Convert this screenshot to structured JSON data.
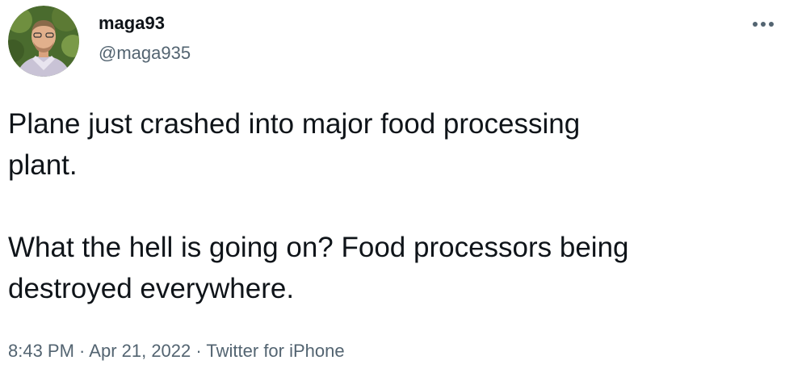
{
  "author": {
    "display_name": "maga93",
    "handle": "@maga935",
    "avatar_icon": "profile-photo"
  },
  "more_icon": "more-horizontal-icon",
  "tweet": {
    "text": "Plane just crashed into major food processing\nplant.\n\nWhat the hell is going on?  Food processors being\ndestroyed everywhere.",
    "time": "8:43 PM",
    "separator": " · ",
    "date": "Apr 21, 2022",
    "source": "Twitter for iPhone"
  },
  "colors": {
    "text_primary": "#0f1419",
    "text_secondary": "#536471",
    "background": "#ffffff"
  }
}
